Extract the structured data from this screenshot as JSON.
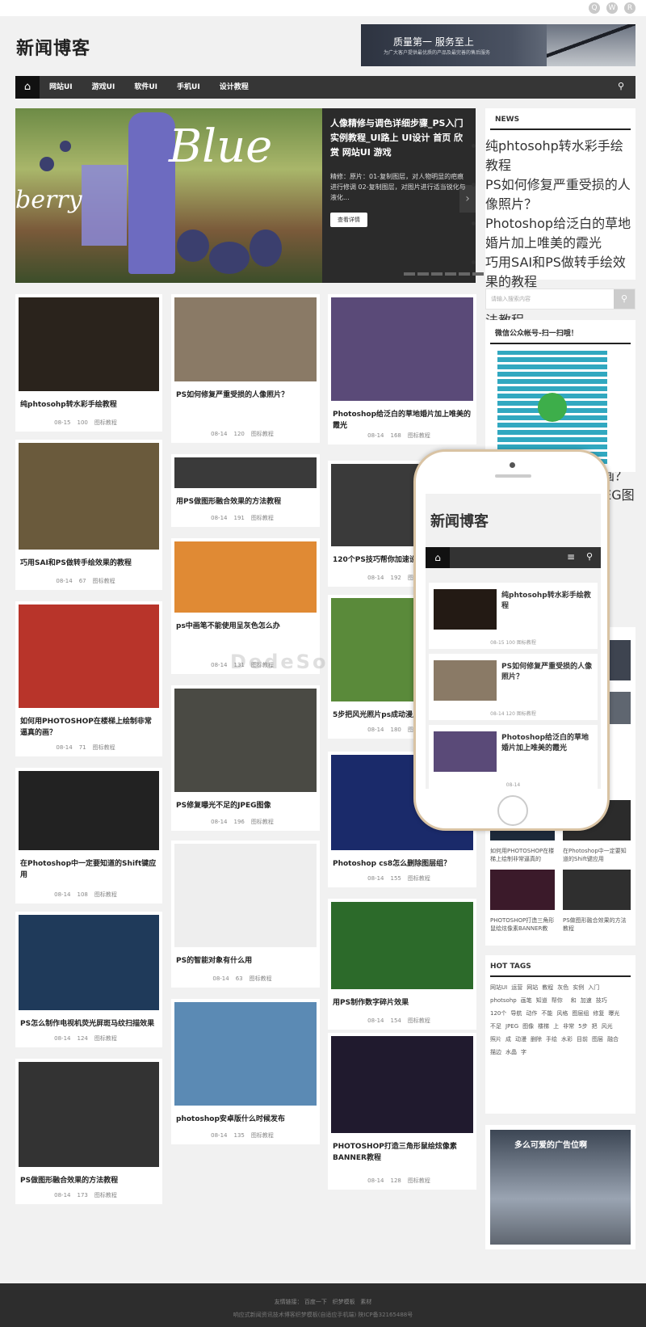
{
  "topbar": {
    "icons": [
      "qq-icon",
      "weibo-icon",
      "rss-icon"
    ]
  },
  "header": {
    "logo": "新闻博客",
    "ad_title": "质量第一 服务至上",
    "ad_sub": "为广大客户提供最优质的产品及最完善的售后服务"
  },
  "nav": {
    "items": [
      "网站UI",
      "游戏UI",
      "软件UI",
      "手机UI",
      "设计教程"
    ]
  },
  "slider": {
    "title": "人像精修与调色详细步骤_PS入门实例教程_UI路上 UI设计 首页 欣赏 网站UI 游戏",
    "desc": "精修：原片：01-复制图层，对人物明显的疤痕进行修调 02-复制图层，对图片进行适当锐化与液化...",
    "button": "查看详情",
    "pic_word1": "Blue",
    "pic_word2": "berry"
  },
  "news": {
    "title": "NEWS",
    "items": [
      "纯phtosohp转水彩手绘教程",
      "PS如何修复严重受损的人像照片？",
      "Photoshop给泛白的草地婚片加上唯美的霞光",
      "巧用SAI和PS做转手绘效果的教程",
      "用PS做图形融合效果的方法教程",
      "120个PS技巧帮你加速设计",
      "ps中画笔不能使用呈灰色怎么办",
      "5步把风光照片ps成动漫风格",
      "如何用PHOTOSHOP在楼梯上绘制非常逼真的画？",
      "PS修复曝光不足的JPEG图像"
    ]
  },
  "search": {
    "placeholder": "请输入搜索内容"
  },
  "wechat": {
    "title": "微信公众帐号-扫一扫哦！"
  },
  "col1": [
    {
      "title": "纯phtosohp转水彩手绘教程",
      "date": "08-15",
      "views": "100",
      "cat": "图标教程"
    },
    {
      "title": "巧用SAI和PS做转手绘效果的教程",
      "date": "08-14",
      "views": "67",
      "cat": "图标教程"
    },
    {
      "title": "如何用PHOTOSHOP在楼梯上绘制非常逼真的画？",
      "date": "08-14",
      "views": "71",
      "cat": "图标教程"
    },
    {
      "title": "在Photoshop中一定要知道的Shift键应用",
      "date": "08-14",
      "views": "108",
      "cat": "图标教程"
    },
    {
      "title": "PS怎么制作电视机荧光屏斑马纹扫描效果",
      "date": "08-14",
      "views": "124",
      "cat": "图标教程"
    },
    {
      "title": "PS做图形融合效果的方法教程",
      "date": "08-14",
      "views": "173",
      "cat": "图标教程"
    }
  ],
  "col2": [
    {
      "title": "PS如何修复严重受损的人像照片？",
      "date": "08-14",
      "views": "120",
      "cat": "图标教程"
    },
    {
      "title": "用PS做图形融合效果的方法教程",
      "date": "08-14",
      "views": "191",
      "cat": "图标教程"
    },
    {
      "title": "ps中画笔不能使用呈灰色怎么办",
      "date": "08-14",
      "views": "131",
      "cat": "图标教程"
    },
    {
      "title": "PS修复曝光不足的JPEG图像",
      "date": "08-14",
      "views": "196",
      "cat": "图标教程"
    },
    {
      "title": "PS的智能对象有什么用",
      "date": "08-14",
      "views": "63",
      "cat": "图标教程"
    },
    {
      "title": "photoshop安卓版什么时候发布",
      "date": "08-14",
      "views": "135",
      "cat": "图标教程"
    }
  ],
  "col3": [
    {
      "title": "Photoshop给泛白的草地婚片加上唯美的霞光",
      "date": "08-14",
      "views": "168",
      "cat": "图标教程"
    },
    {
      "title": "120个PS技巧帮你加速设计",
      "date": "08-14",
      "views": "192",
      "cat": "图标教程"
    },
    {
      "title": "5步把风光照片ps成动漫风格",
      "date": "08-14",
      "views": "180",
      "cat": "图标教程"
    },
    {
      "title": "Photoshop cs8怎么删除图层组？",
      "date": "08-14",
      "views": "155",
      "cat": "图标教程"
    },
    {
      "title": "用PS制作数字碎片效果",
      "date": "08-14",
      "views": "154",
      "cat": "图标教程"
    },
    {
      "title": "PHOTOSHOP打造三角形鼠绘炫像素BANNER教程",
      "date": "08-14",
      "views": "128",
      "cat": "图标教程"
    }
  ],
  "phone": {
    "logo": "新闻博客",
    "cards": [
      {
        "title": "纯phtosohp转水彩手绘教程",
        "meta": "08-15  100  图标教程"
      },
      {
        "title": "PS如何修复严重受损的人像照片？",
        "meta": "08-14  120  图标教程"
      },
      {
        "title": "Photoshop给泛白的草地婚片加上唯美的霞光",
        "meta": "08-14"
      }
    ]
  },
  "side_thumbs": [
    {
      "title": "如何用PHOTOSHOP在楼梯上绘制非常逼真的"
    },
    {
      "title": "在Photoshop中一定要知道的Shift键应用"
    },
    {
      "title": "PHOTOSHOP打造三角形鼠绘炫像素BANNER教"
    },
    {
      "title": "PS做图形融合效果的方法教程"
    }
  ],
  "hot_tags": {
    "title": "HOT TAGS",
    "items": [
      "网站UI",
      "运营",
      "网站",
      "教程",
      "灰色",
      "实例",
      "入门",
      "photsohp",
      "画笔",
      "知道",
      "帮你",
      "",
      "和",
      "加速",
      "技巧",
      "120个",
      "导航",
      "动作",
      "不能",
      "风格",
      "图层组",
      "修复",
      "曝光",
      "不足",
      "JPEG",
      "图像",
      "楼梯",
      "上",
      "非常",
      "5步",
      "把",
      "风光",
      "照片",
      "成",
      "动漫",
      "删除",
      "手绘",
      "水彩",
      "目前",
      "图层",
      "融合",
      "描边",
      "水晶",
      "字"
    ]
  },
  "ad2": {
    "title": "多么可爱的广告位啊"
  },
  "footer": {
    "links_label": "友情链接：",
    "links": [
      "百度一下",
      "织梦模板",
      "素材"
    ],
    "copyright": "响应式新闻资讯技术博客织梦模板(自适应手机端) 陕ICP备32165488号"
  },
  "watermark": "DedeSo"
}
